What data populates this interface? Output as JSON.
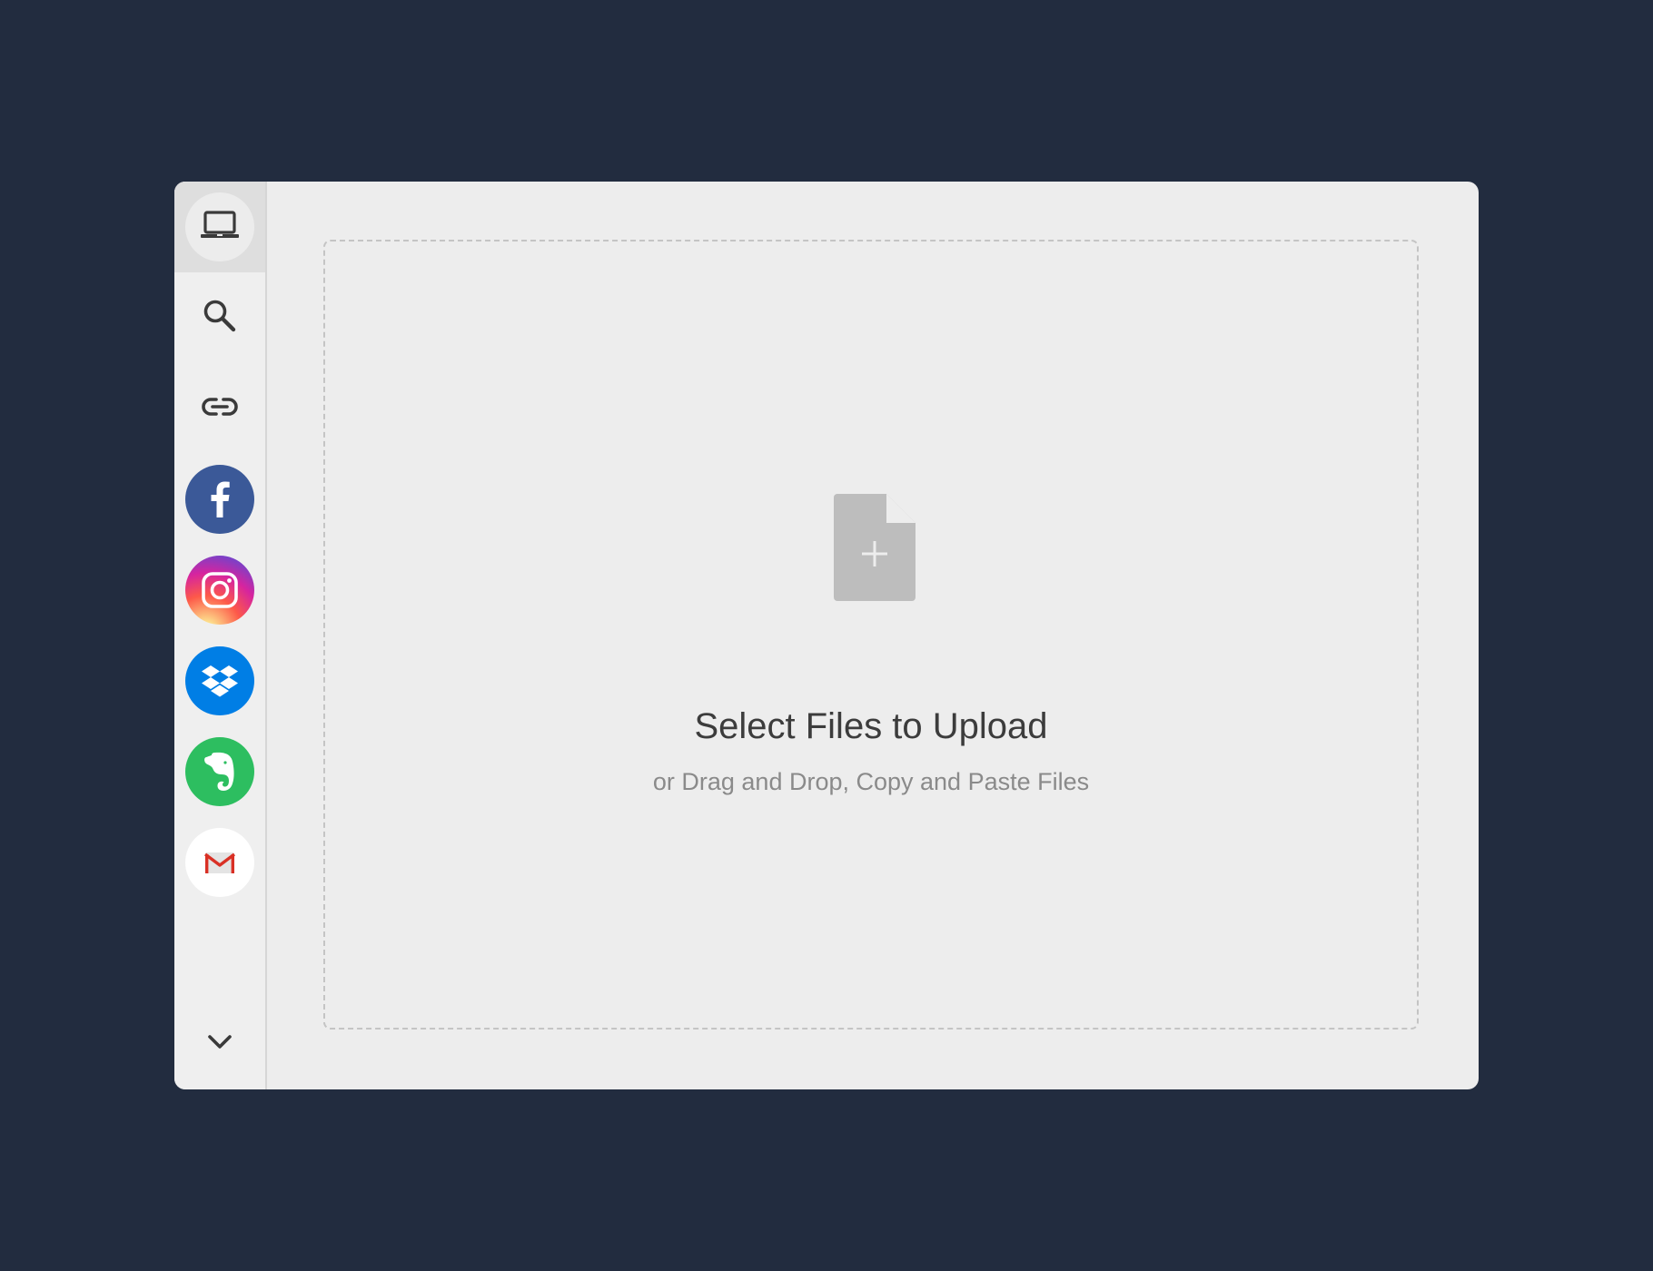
{
  "sources": [
    {
      "name": "My Device",
      "icon": "laptop-icon",
      "active": true
    },
    {
      "name": "Web Search",
      "icon": "search-icon",
      "active": false
    },
    {
      "name": "Link (URL)",
      "icon": "link-icon",
      "active": false
    },
    {
      "name": "Facebook",
      "icon": "facebook-icon",
      "color": "#3b5998",
      "active": false
    },
    {
      "name": "Instagram",
      "icon": "instagram-icon",
      "color": "#d6249f",
      "active": false
    },
    {
      "name": "Dropbox",
      "icon": "dropbox-icon",
      "color": "#007ee5",
      "active": false
    },
    {
      "name": "Evernote",
      "icon": "evernote-icon",
      "color": "#2dbe60",
      "active": false
    },
    {
      "name": "Gmail",
      "icon": "gmail-icon",
      "color": "#ffffff",
      "active": false
    }
  ],
  "more_icon": "chevron-down-icon",
  "dropzone": {
    "title": "Select Files to Upload",
    "subtitle": "or Drag and Drop, Copy and Paste Files"
  },
  "colors": {
    "background": "#222c3f",
    "panel": "#ededed",
    "facebook": "#3b5998",
    "dropbox": "#007ee5",
    "evernote": "#2dbe60",
    "gmail_red": "#d93025"
  }
}
